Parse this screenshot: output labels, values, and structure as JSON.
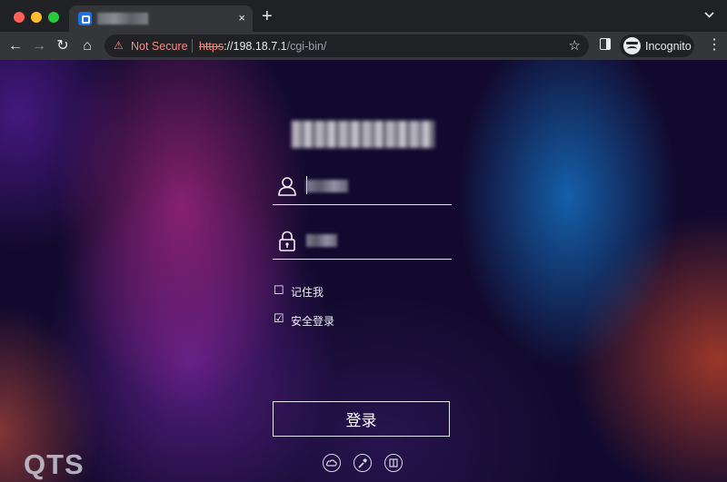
{
  "browser": {
    "tab": {
      "favicon": "qnap-favicon-icon",
      "title": "",
      "close_label": "×"
    },
    "new_tab_label": "+",
    "tab_menu_label": "⌄",
    "toolbar": {
      "back_label": "←",
      "forward_label": "→",
      "reload_label": "↻",
      "home_label": "⌂",
      "security_icon": "⚠",
      "security_text": "Not Secure",
      "url_scheme": "https",
      "url_host": "://198.18.7.1",
      "url_path": "/cgi-bin/",
      "bookmark_label": "☆",
      "incognito_label": "Incognito",
      "menu_label": "⋮"
    }
  },
  "login": {
    "brand_name": "",
    "username": {
      "icon": "user-icon",
      "value": ""
    },
    "password": {
      "icon": "lock-icon",
      "value": ""
    },
    "remember_me": {
      "checked_symbol": "☐",
      "label": "记住我"
    },
    "secure_login": {
      "checked_symbol": "☑",
      "label": "安全登录"
    },
    "submit_label": "登录",
    "logo": "QTS",
    "footer_icons": [
      "cloud-icon",
      "tool-icon",
      "book-icon"
    ]
  }
}
